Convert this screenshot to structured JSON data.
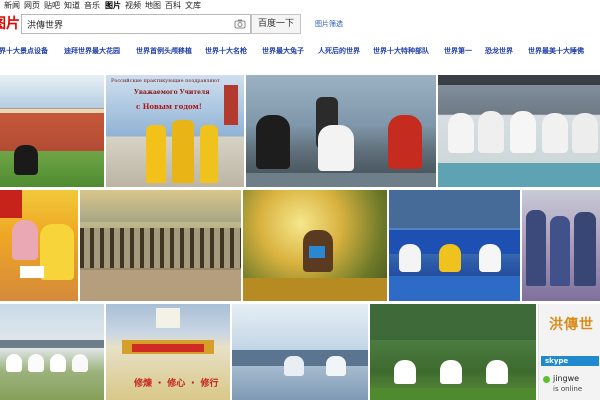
{
  "nav": {
    "items": [
      {
        "label": "新闻",
        "active": false
      },
      {
        "label": "网页",
        "active": false
      },
      {
        "label": "贴吧",
        "active": false
      },
      {
        "label": "知道",
        "active": false
      },
      {
        "label": "音乐",
        "active": false
      },
      {
        "label": "图片",
        "active": true
      },
      {
        "label": "视频",
        "active": false
      },
      {
        "label": "地图",
        "active": false
      },
      {
        "label": "百科",
        "active": false
      },
      {
        "label": "文库",
        "active": false
      }
    ]
  },
  "logo": {
    "text": "图片"
  },
  "search": {
    "value": "洪傳世界",
    "camera_icon": "camera-icon"
  },
  "search_button": {
    "label": "百度一下"
  },
  "filter": {
    "label": "图片筛选"
  },
  "suggestions": [
    "世界十大景点设备",
    "迪拜世界最大花园",
    "世界首例头颅移植",
    "世界十大名枪",
    "世界最大兔子",
    "人死后的世界",
    "世界十大特种部队",
    "世界第一",
    "恐龙世界",
    "世界最美十大睡佛"
  ],
  "tiles": {
    "t2_caption1": "Российские практикующие поздравляют",
    "t2_caption2": "Уважаемого Учителя",
    "t2_caption3": "с Новым годом!",
    "t11_banner": "修煉 ‧ 修心 ‧ 修行",
    "t14_title": "洪傳世",
    "t14_app": "skype",
    "t14_name": "jingwe",
    "t14_status": "is online"
  },
  "colors": {
    "accent_red": "#e10601",
    "link_blue": "#1f3fa8"
  }
}
